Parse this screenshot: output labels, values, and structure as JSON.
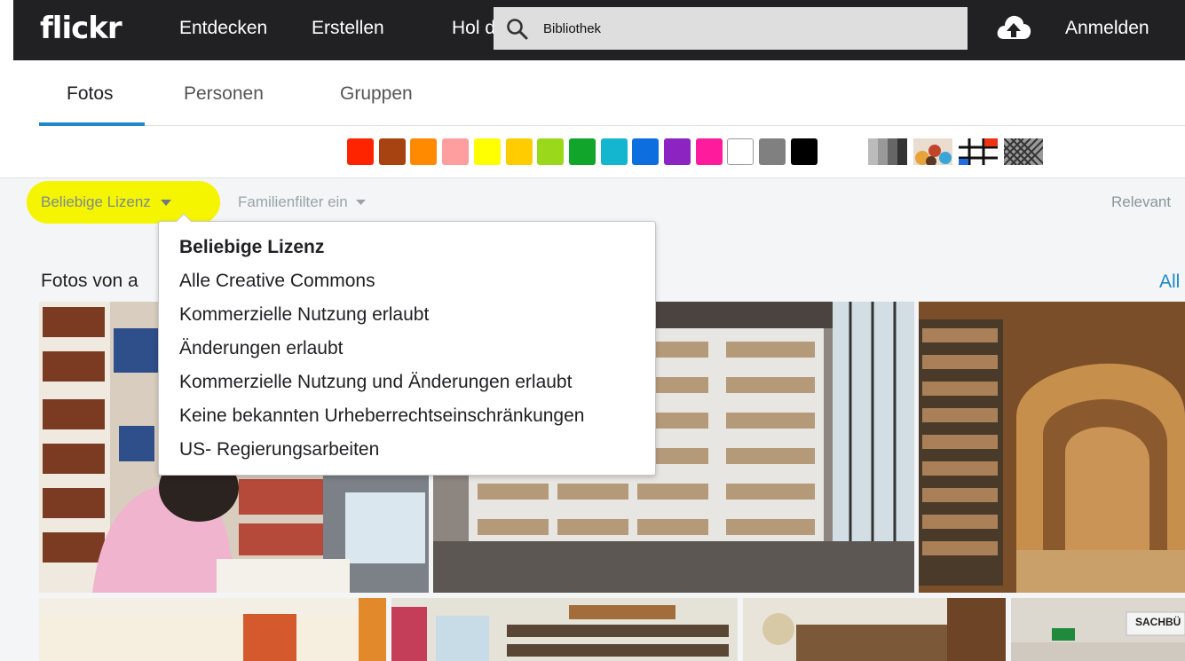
{
  "nav": {
    "logo": "flickr",
    "links": [
      "Entdecken",
      "Erstellen",
      "Hol di"
    ],
    "search_value": "Bibliothek",
    "signin": "Anmelden"
  },
  "tabs": [
    {
      "label": "Fotos",
      "active": true
    },
    {
      "label": "Personen",
      "active": false
    },
    {
      "label": "Gruppen",
      "active": false
    }
  ],
  "color_filters": [
    "#ff2400",
    "#a64310",
    "#ff8a00",
    "#ff9e9e",
    "#ffff00",
    "#ffcc00",
    "#99d81a",
    "#12a52c",
    "#14b6cf",
    "#0d6ee0",
    "#8c24c2",
    "#ff1c9c",
    "#ffffff",
    "#808080",
    "#000000"
  ],
  "style_filters": [
    "black-and-white-icon",
    "shallow-depth-of-field-icon",
    "minimalist-icon",
    "patterns-icon"
  ],
  "filters": {
    "license": "Beliebige Lizenz",
    "family": "Familienfilter ein",
    "sort": "Relevant"
  },
  "section": {
    "title": "Fotos von a",
    "view_all": "All"
  },
  "license_menu": {
    "items": [
      "Beliebige Lizenz",
      "Alle Creative Commons",
      "Kommerzielle Nutzung erlaubt",
      "Änderungen erlaubt",
      "Kommerzielle Nutzung und Änderungen erlaubt",
      "Keine bekannten Urheberrechtseinschränkungen",
      "US- Regierungsarbeiten"
    ],
    "selected_index": 0
  },
  "photos": {
    "sign_text": "SACHBÜ"
  },
  "colors": {
    "nav_bg": "#212124",
    "accent": "#1e88c8",
    "highlight": "#f5f500"
  }
}
